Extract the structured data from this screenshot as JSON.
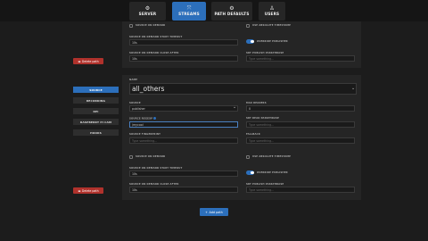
{
  "nav": {
    "tabs": [
      {
        "label": "SERVER",
        "icon": "gear-icon"
      },
      {
        "label": "STREAMS",
        "icon": "streams-icon"
      },
      {
        "label": "PATH DEFAULTS",
        "icon": "path-defaults-icon"
      },
      {
        "label": "USERS",
        "icon": "user-icon"
      }
    ]
  },
  "top": {
    "left_check_label": "SOURCE ON DEMAND",
    "right_check_label": "USE ABSOLUTE TIMESTAMP",
    "ondemand_start_label": "SOURCE ON DEMAND START TIMEOUT",
    "ondemand_start_value": "10s",
    "override_label": "OVERRIDE PUBLISHER",
    "ondemand_close_label": "SOURCE ON DEMAND CLOSE AFTER",
    "ondemand_close_value": "10s",
    "fwd_label": "SRT PUBLISH PASSPHRASE",
    "fwd_placeholder": "Type something...",
    "delete_label": "Delete path"
  },
  "sidebar": {
    "items": [
      "SOURCE",
      "RECORDING",
      "RPI",
      "RASPBERRY PI CAM",
      "HOOKS"
    ]
  },
  "path": {
    "name_label": "NAME",
    "name_value": "all_others",
    "source_label": "SOURCE",
    "source_value": "publisher",
    "max_readers_label": "MAX READERS",
    "max_readers_value": "0",
    "regexp_label": "SOURCE REGEXP",
    "regexp_value": "/mycool",
    "srt_label": "SRT READ PASSPHRASE",
    "srt_placeholder": "Type something...",
    "fingerprint_label": "SOURCE FINGERPRINT",
    "fingerprint_placeholder": "Type something...",
    "fallback_label": "FALLBACK",
    "fallback_placeholder": "Type something...",
    "ondemand_label": "SOURCE ON DEMAND",
    "abs_ts_label": "USE ABSOLUTE TIMESTAMP",
    "start_timeout_label": "SOURCE ON DEMAND START TIMEOUT",
    "start_timeout_value": "10s",
    "override_label": "OVERRIDE PUBLISHER",
    "close_after_label": "SOURCE ON DEMAND CLOSE AFTER",
    "close_after_value": "10s",
    "passphrase_label": "SRT PUBLISH PASSPHRASE",
    "passphrase_placeholder": "Type something...",
    "delete_label": "Delete path"
  },
  "footer": {
    "add_label": "Add path"
  }
}
